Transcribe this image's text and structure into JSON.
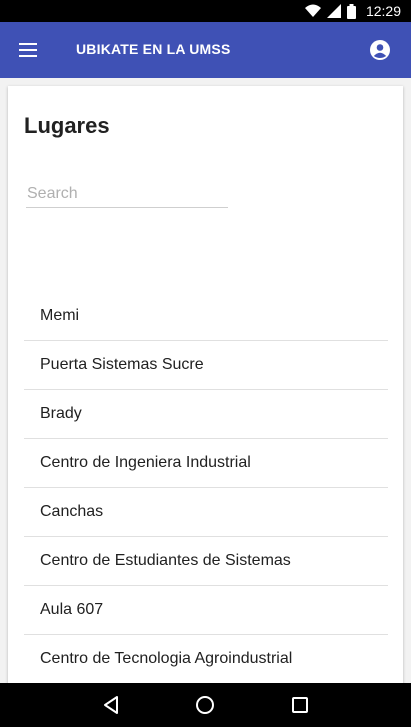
{
  "status_bar": {
    "time": "12:29",
    "icons": [
      "wifi-icon",
      "signal-icon",
      "battery-icon"
    ]
  },
  "app_bar": {
    "title": "UBIKATE EN LA UMSS",
    "menu_icon": "menu-icon",
    "account_icon": "account-circle-icon",
    "color": "#3f51b5"
  },
  "main": {
    "title": "Lugares",
    "search": {
      "placeholder": "Search",
      "value": ""
    },
    "places": [
      "Memi",
      "Puerta Sistemas Sucre",
      "Brady",
      "Centro de Ingeniera Industrial",
      "Canchas",
      "Centro de Estudiantes de Sistemas",
      "Aula 607",
      "Centro de Tecnologia Agroindustrial"
    ]
  },
  "nav_bar": {
    "icons": [
      "back-icon",
      "home-icon",
      "recents-icon"
    ]
  }
}
